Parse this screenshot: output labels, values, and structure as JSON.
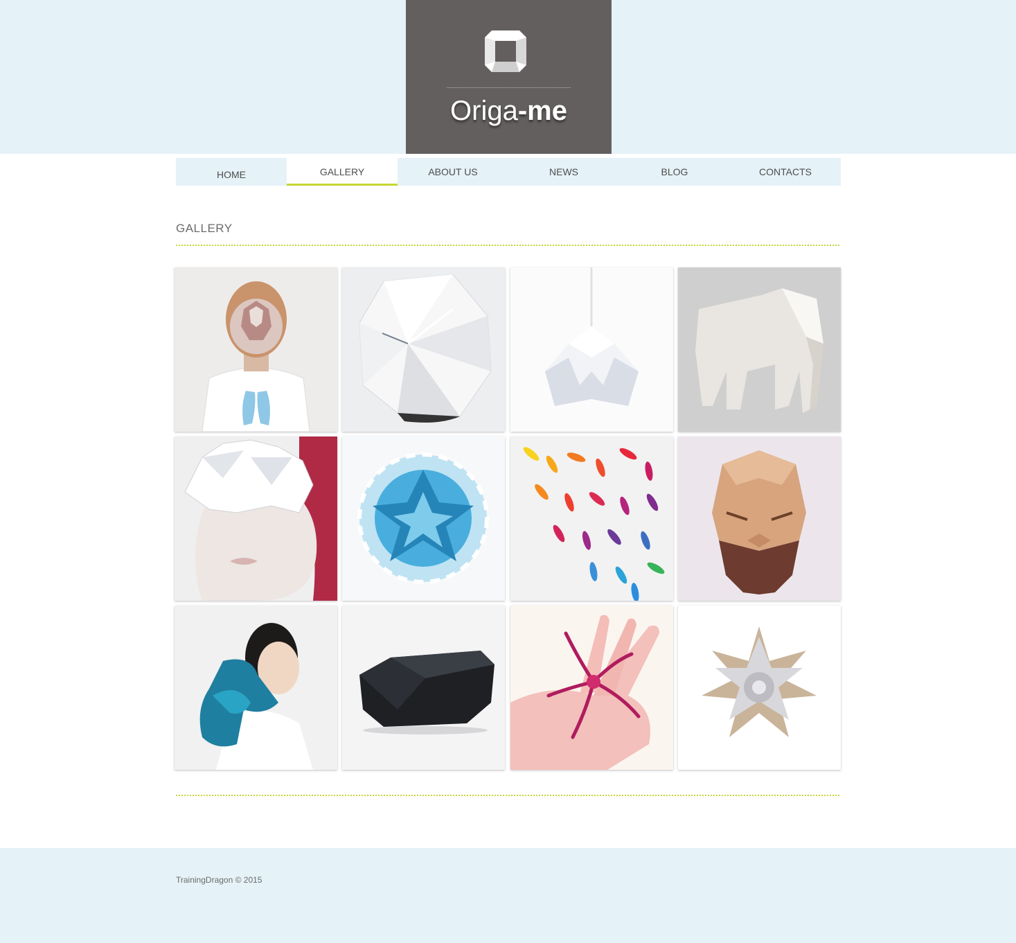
{
  "brand": {
    "name_light": "Origa",
    "name_bold": "-me",
    "logo_icon": "folded-square-icon"
  },
  "nav": {
    "items": [
      {
        "label": "HOME",
        "active": false
      },
      {
        "label": "GALLERY",
        "active": true
      },
      {
        "label": "ABOUT US",
        "active": false
      },
      {
        "label": "NEWS",
        "active": false
      },
      {
        "label": "BLOG",
        "active": false
      },
      {
        "label": "CONTACTS",
        "active": false
      }
    ]
  },
  "main": {
    "title": "GALLERY",
    "gallery": [
      {
        "subject": "man-with-paper-mask"
      },
      {
        "subject": "origami-clock"
      },
      {
        "subject": "origami-pendant-lamp"
      },
      {
        "subject": "origami-elephant"
      },
      {
        "subject": "woman-with-paper-crown"
      },
      {
        "subject": "blue-kusudama-ball"
      },
      {
        "subject": "rainbow-paper-fish"
      },
      {
        "subject": "origami-bearded-mask"
      },
      {
        "subject": "woman-with-blue-paper-collar"
      },
      {
        "subject": "black-faceted-object"
      },
      {
        "subject": "paper-starfish-on-hand"
      },
      {
        "subject": "origami-star"
      }
    ]
  },
  "footer": {
    "copyright": "TrainingDragon © 2015"
  },
  "colors": {
    "background_band": "#e5f2f8",
    "logo_box": "#625f5e",
    "accent": "#c6d631",
    "text": "#4d4d4d"
  }
}
